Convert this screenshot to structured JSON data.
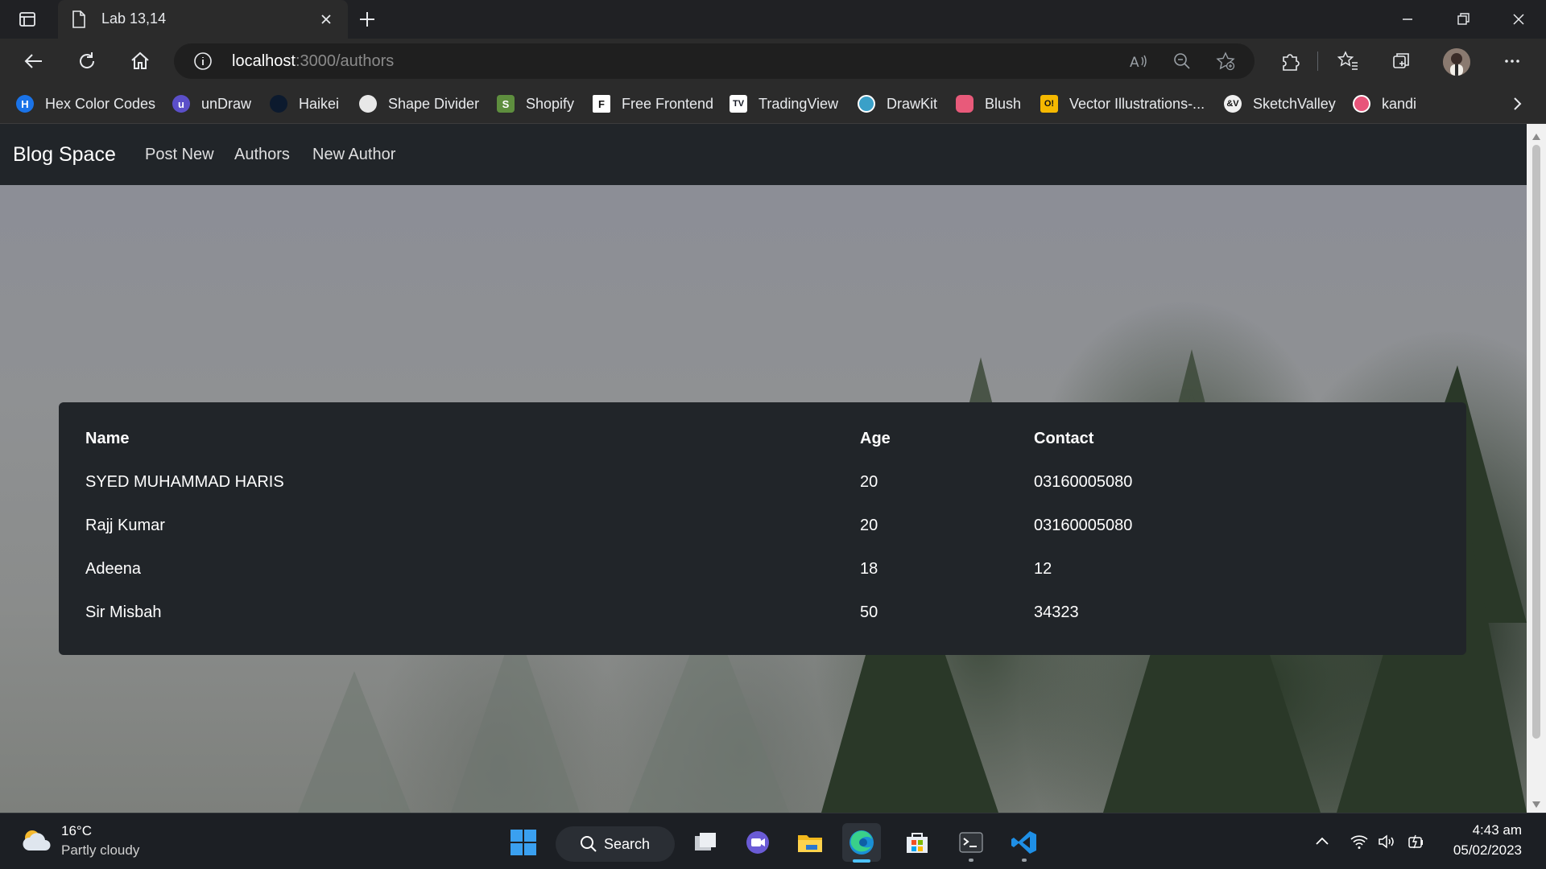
{
  "browser": {
    "tab_title": "Lab 13,14",
    "url_host": "localhost",
    "url_path": ":3000/authors",
    "icons": {
      "window_menu": "window-menu-icon",
      "tab_page": "document-icon",
      "tab_close": "close-icon",
      "new_tab": "plus-icon",
      "minimize": "minimize-icon",
      "maximize": "restore-icon",
      "close": "close-icon",
      "back": "back-arrow-icon",
      "refresh": "refresh-icon",
      "home": "home-icon",
      "site_info": "info-icon",
      "read_aloud": "read-aloud-icon",
      "zoom": "zoom-out-icon",
      "add_favorite": "star-plus-icon",
      "extensions": "puzzle-icon",
      "favorites": "favorites-icon",
      "collections": "collections-icon",
      "more": "more-icon"
    }
  },
  "bookmarks": [
    {
      "label": "Hex Color Codes",
      "icon": "H",
      "color": "#1a73e8"
    },
    {
      "label": "unDraw",
      "icon": "u",
      "color": "#5b4fc9"
    },
    {
      "label": "Haikei",
      "icon": "",
      "color": "#0c1a2e"
    },
    {
      "label": "Shape Divider",
      "icon": "",
      "color": "#e8e8e8"
    },
    {
      "label": "Shopify",
      "icon": "S",
      "color": "#5e8e3e"
    },
    {
      "label": "Free Frontend",
      "icon": "F",
      "color": "#ffffff"
    },
    {
      "label": "TradingView",
      "icon": "TV",
      "color": "#131722"
    },
    {
      "label": "DrawKit",
      "icon": "",
      "color": "#3aa0c8"
    },
    {
      "label": "Blush",
      "icon": "",
      "color": "#e85a7a"
    },
    {
      "label": "Vector Illustrations-...",
      "icon": "O!",
      "color": "#f5b800"
    },
    {
      "label": "SketchValley",
      "icon": "&V",
      "color": "#222222"
    },
    {
      "label": "kandi",
      "icon": "",
      "color": "#e8557a"
    }
  ],
  "site": {
    "brand": "Blog Space",
    "nav": [
      "Post New",
      "Authors",
      "New Author"
    ]
  },
  "authors_table": {
    "headers": [
      "Name",
      "Age",
      "Contact"
    ],
    "rows": [
      [
        "SYED MUHAMMAD HARIS",
        "20",
        "03160005080"
      ],
      [
        "Rajj Kumar",
        "20",
        "03160005080"
      ],
      [
        "Adeena",
        "18",
        "12"
      ],
      [
        "Sir Misbah",
        "50",
        "34323"
      ]
    ]
  },
  "taskbar": {
    "weather_temp": "16°C",
    "weather_desc": "Partly cloudy",
    "search_label": "Search",
    "time": "4:43 am",
    "date": "05/02/2023",
    "apps": [
      "windows-start-icon",
      "search-icon",
      "task-view-icon",
      "teams-chat-icon",
      "file-explorer-icon",
      "edge-icon",
      "store-icon",
      "terminal-icon",
      "vscode-icon"
    ],
    "tray": [
      "chevron-up-icon",
      "wifi-icon",
      "volume-icon",
      "battery-icon"
    ]
  },
  "colors": {
    "navbar_bg": "#212529",
    "table_bg": "#212529",
    "browser_chrome": "#2b2b2b",
    "taskbar_bg": "#1c1f24",
    "edge_accent": "#4cc2ff"
  }
}
